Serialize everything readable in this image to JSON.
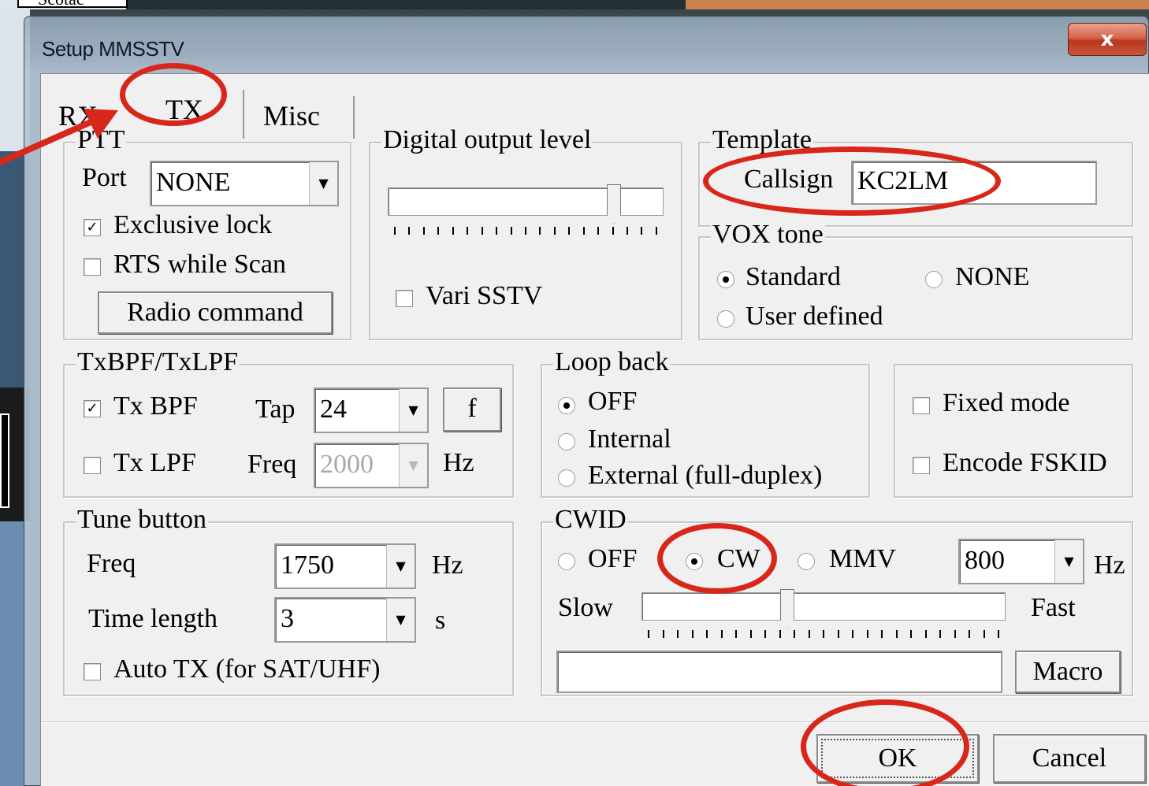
{
  "background": {
    "label": "Scotac"
  },
  "window": {
    "title": "Setup MMSSTV",
    "close_glyph": "x"
  },
  "tabs": [
    "RX",
    "TX",
    "Misc"
  ],
  "active_tab": "TX",
  "ptt": {
    "legend": "PTT",
    "port_label": "Port",
    "port_value": "NONE",
    "exclusive_lock_label": "Exclusive lock",
    "exclusive_lock_checked": true,
    "rts_while_scan_label": "RTS while Scan",
    "rts_while_scan_checked": false,
    "radio_command_label": "Radio command"
  },
  "digital_output": {
    "legend": "Digital output level",
    "level": 0.82,
    "vari_sstv_label": "Vari SSTV",
    "vari_sstv_checked": false
  },
  "template": {
    "legend": "Template",
    "callsign_label": "Callsign",
    "callsign_value": "KC2LM"
  },
  "vox_tone": {
    "legend": "VOX tone",
    "options": [
      "Standard",
      "NONE",
      "User defined"
    ],
    "selected": "Standard"
  },
  "txbpf": {
    "legend": "TxBPF/TxLPF",
    "tx_bpf_label": "Tx BPF",
    "tx_bpf_checked": true,
    "tap_label": "Tap",
    "tap_value": "24",
    "f_button": "f",
    "tx_lpf_label": "Tx LPF",
    "tx_lpf_checked": false,
    "freq_label": "Freq",
    "freq_value": "2000",
    "hz": "Hz"
  },
  "loop_back": {
    "legend": "Loop back",
    "options": [
      "OFF",
      "Internal",
      "External (full-duplex)"
    ],
    "selected": "OFF"
  },
  "modes": {
    "fixed_mode_label": "Fixed mode",
    "fixed_mode_checked": false,
    "encode_fskid_label": "Encode FSKID",
    "encode_fskid_checked": false
  },
  "tune": {
    "legend": "Tune button",
    "freq_label": "Freq",
    "freq_value": "1750",
    "hz": "Hz",
    "time_label": "Time length",
    "time_value": "3",
    "s": "s",
    "auto_tx_label": "Auto TX (for SAT/UHF)",
    "auto_tx_checked": false
  },
  "cwid": {
    "legend": "CWID",
    "options": [
      "OFF",
      "CW",
      "MMV"
    ],
    "selected": "CW",
    "freq_value": "800",
    "hz": "Hz",
    "slow_label": "Slow",
    "fast_label": "Fast",
    "speed": 0.4,
    "text_value": "",
    "macro_label": "Macro"
  },
  "footer": {
    "ok_label": "OK",
    "cancel_label": "Cancel"
  },
  "colors": {
    "annotation": "#d8261a",
    "dialog_bg": "#f0f0f0"
  }
}
